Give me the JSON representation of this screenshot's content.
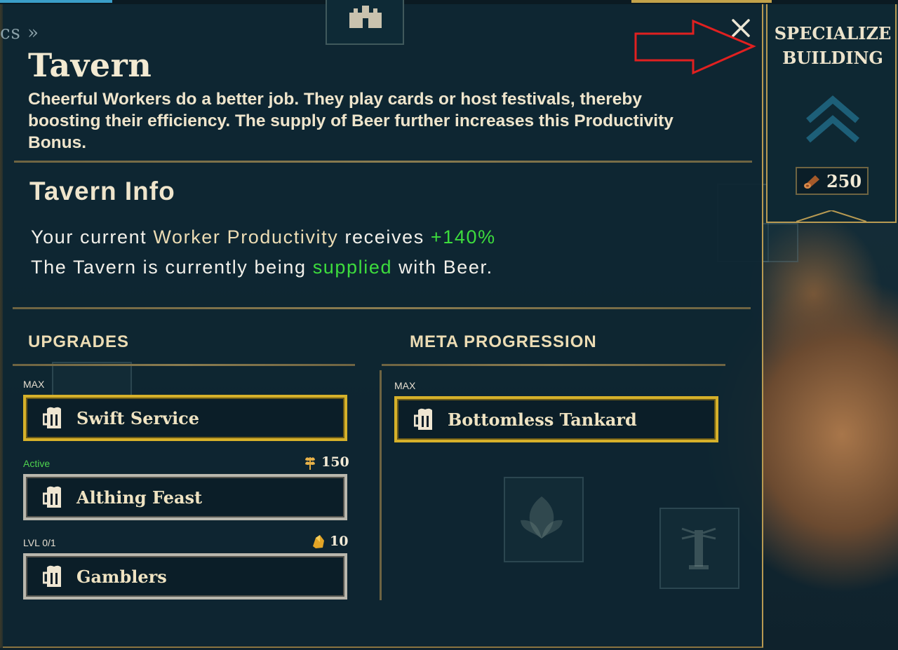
{
  "nav": {
    "chevron_text": "cs »"
  },
  "panel": {
    "title": "Tavern",
    "description": "Cheerful Workers do a better job. They play cards or host festivals, thereby boosting their efficiency. The supply of Beer further increases this Productivity Bonus.",
    "close_icon": "close-icon"
  },
  "info": {
    "title": "Tavern Info",
    "line1": {
      "prefix": "Your current ",
      "highlight": "Worker Productivity",
      "middle": " receives ",
      "value": "+140%"
    },
    "line2": {
      "prefix": "The Tavern is currently being ",
      "highlight": "supplied",
      "suffix": " with Beer."
    }
  },
  "upgrades": {
    "heading": "UPGRADES",
    "items": [
      {
        "status": "MAX",
        "label": "Swift Service",
        "icon": "beer-mug-icon",
        "frame": "gold"
      },
      {
        "status": "Active",
        "label": "Althing Feast",
        "icon": "beer-mug-icon",
        "frame": "silver",
        "cost": "150",
        "cost_icon": "wheat-icon"
      },
      {
        "status": "LVL 0/1",
        "label": "Gamblers",
        "icon": "beer-mug-icon",
        "frame": "silver",
        "cost": "10",
        "cost_icon": "gold-nugget-icon"
      }
    ]
  },
  "meta": {
    "heading": "META PROGRESSION",
    "items": [
      {
        "status": "MAX",
        "label": "Bottomless Tankard",
        "icon": "beer-mug-icon",
        "frame": "gold"
      }
    ]
  },
  "specialize": {
    "title_line1": "SPECIALIZE",
    "title_line2": "BUILDING",
    "cost": "250",
    "cost_icon": "wood-log-icon",
    "icon": "double-chevron-up-icon"
  },
  "colors": {
    "gold_frame": "#d6b12a",
    "silver_frame": "#b9b7ad",
    "green_highlight": "#3ddc3d",
    "beige_highlight": "#ecdcb4",
    "panel_bg": "#0e2632",
    "annotation_arrow": "#e02020"
  }
}
